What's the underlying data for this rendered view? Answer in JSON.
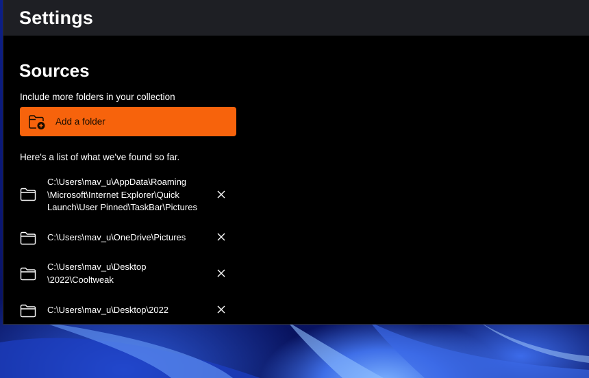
{
  "window": {
    "title": "Settings"
  },
  "sources": {
    "title": "Sources",
    "subtitle": "Include more folders in your collection",
    "add_button": {
      "label": "Add a folder",
      "icon": "folder-add-icon",
      "color": "#f7630c"
    },
    "found_text": "Here's a list of what we've found so far.",
    "folders": [
      {
        "path": "C:\\Users\\mav_u\\AppData\\Roaming\n\\Microsoft\\Internet Explorer\\Quick\nLaunch\\User Pinned\\TaskBar\\Pictures",
        "icon": "folder-icon",
        "remove_icon": "close-icon"
      },
      {
        "path": "C:\\Users\\mav_u\\OneDrive\\Pictures",
        "icon": "folder-icon",
        "remove_icon": "close-icon"
      },
      {
        "path": "C:\\Users\\mav_u\\Desktop\n\\2022\\Cooltweak",
        "icon": "folder-icon",
        "remove_icon": "close-icon"
      },
      {
        "path": "C:\\Users\\mav_u\\Desktop\\2022",
        "icon": "folder-icon",
        "remove_icon": "close-icon"
      }
    ]
  },
  "theme": {
    "background": "#000000",
    "titlebar": "#1e1f24",
    "accent": "#f7630c",
    "text": "#ffffff"
  }
}
